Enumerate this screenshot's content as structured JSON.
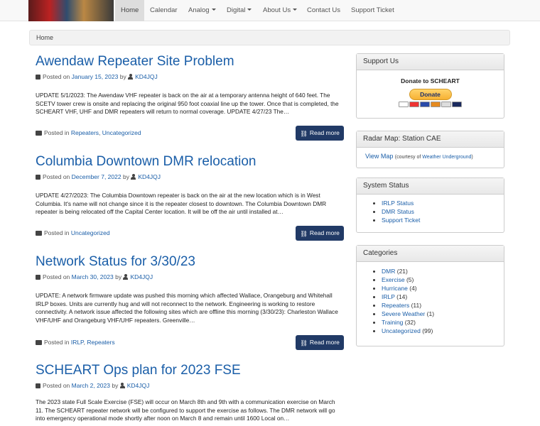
{
  "nav": {
    "items": [
      {
        "label": "Home",
        "active": true
      },
      {
        "label": "Calendar"
      },
      {
        "label": "Analog",
        "dropdown": true
      },
      {
        "label": "Digital",
        "dropdown": true
      },
      {
        "label": "About Us",
        "dropdown": true
      },
      {
        "label": "Contact Us"
      },
      {
        "label": "Support Ticket"
      }
    ]
  },
  "breadcrumb": "Home",
  "posts": [
    {
      "title": "Awendaw Repeater Site Problem",
      "posted_on_label": "Posted on",
      "date": "January 15, 2023",
      "by": "by",
      "author": "KD4JQJ",
      "excerpt": "UPDATE 5/1/2023: The Awendaw VHF repeater is back on the air at a temporary antenna height of 640 feet.  The SCETV tower crew is onsite and replacing the original 950 foot coaxial line up the tower.  Once that is completed, the SCHEART VHF, UHF and DMR repeaters will return to normal coverage.  UPDATE 4/27/23 The…",
      "posted_in_label": "Posted in",
      "categories": [
        "Repeaters",
        "Uncategorized"
      ],
      "read_more": "Read more"
    },
    {
      "title": "Columbia Downtown DMR relocation",
      "posted_on_label": "Posted on",
      "date": "December 7, 2022",
      "by": "by",
      "author": "KD4JQJ",
      "excerpt": "UPDATE 4/27/2023: The Columbia Downtown repeater is back on the air at the new location which is in West Columbia.  It's name will not change since it is the repeater closest to downtown. The Columbia Downtown DMR repeater is being relocated off the Capital Center location.  It will be off the air until installed at…",
      "posted_in_label": "Posted in",
      "categories": [
        "Uncategorized"
      ],
      "read_more": "Read more"
    },
    {
      "title": "Network Status for 3/30/23",
      "posted_on_label": "Posted on",
      "date": "March 30, 2023",
      "by": "by",
      "author": "KD4JQJ",
      "excerpt": "UPDATE:  A network firmware update was pushed this morning which affected Wallace, Orangeburg and Whitehall IRLP boxes.  Units are currently hug and will not reconnect to the network. Engineering is working to restore connectivity. A network issue affected the following sites which are offline this morning (3/30/23): Charleston Wallace VHF/UHF and Orangeburg VHF/UHF repeaters.  Greenville…",
      "posted_in_label": "Posted in",
      "categories": [
        "IRLP",
        "Repeaters"
      ],
      "read_more": "Read more"
    },
    {
      "title": "SCHEART Ops plan for 2023 FSE",
      "posted_on_label": "Posted on",
      "date": "March 2, 2023",
      "by": "by",
      "author": "KD4JQJ",
      "excerpt": "The 2023 state Full Scale Exercise (FSE) will occur on March 8th and 9th with a communication exercise on March 11.  The SCHEART repeater network will be configured to support the exercise as follows. The DMR network will go into emergency operational mode shortly after noon on March 8 and remain until 1600 Local on…"
    }
  ],
  "sidebar": {
    "support": {
      "title": "Support Us",
      "donate_heading": "Donate to SCHEART",
      "donate_button": "Donate"
    },
    "radar": {
      "title": "Radar Map: Station CAE",
      "link": "View Map",
      "note_pre": "(courtesy of ",
      "note_link": "Weather Underground",
      "note_post": ")"
    },
    "status": {
      "title": "System Status",
      "items": [
        "IRLP Status",
        "DMR Status",
        "Support Ticket"
      ]
    },
    "categories": {
      "title": "Categories",
      "items": [
        {
          "name": "DMR",
          "count": "(21)"
        },
        {
          "name": "Exercise",
          "count": "(5)"
        },
        {
          "name": "Hurricane",
          "count": "(4)"
        },
        {
          "name": "IRLP",
          "count": "(14)"
        },
        {
          "name": "Repeaters",
          "count": "(11)"
        },
        {
          "name": "Severe Weather",
          "count": "(1)"
        },
        {
          "name": "Training",
          "count": "(32)"
        },
        {
          "name": "Uncategorized",
          "count": "(99)"
        }
      ]
    }
  },
  "colors": {
    "link": "#1a5ea8",
    "button": "#213a66",
    "donate": "#f7b133"
  },
  "icons": [
    "calendar-icon",
    "user-icon",
    "folder-icon",
    "link-icon",
    "caret-down-icon"
  ]
}
